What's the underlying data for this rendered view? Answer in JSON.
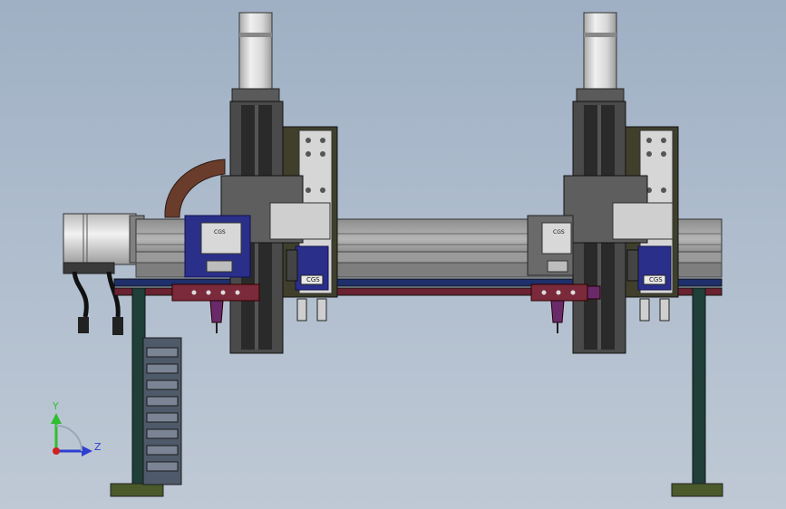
{
  "viewport": {
    "background_top": "#9fb0c4",
    "background_bottom": "#bfc9d5"
  },
  "triad": {
    "y_label": "Y",
    "z_label": "Z",
    "y_color": "#2fbf2f",
    "z_color": "#2d3fd0",
    "x_color": "#d02020"
  },
  "model": {
    "module_labels": [
      "CGS",
      "CGS",
      "CGS",
      "CGS"
    ],
    "colors": {
      "frame": "#6e6e6e",
      "legs": "#1f3f38",
      "foot_plates": "#4a5a2a",
      "carriage_blue": "#2a2f8a",
      "bracket_red": "#7a2a3a",
      "bracket_purple": "#6a2a6a",
      "cable_chain": "#6a3c2c",
      "motor_body": "#cfcfcf"
    }
  }
}
